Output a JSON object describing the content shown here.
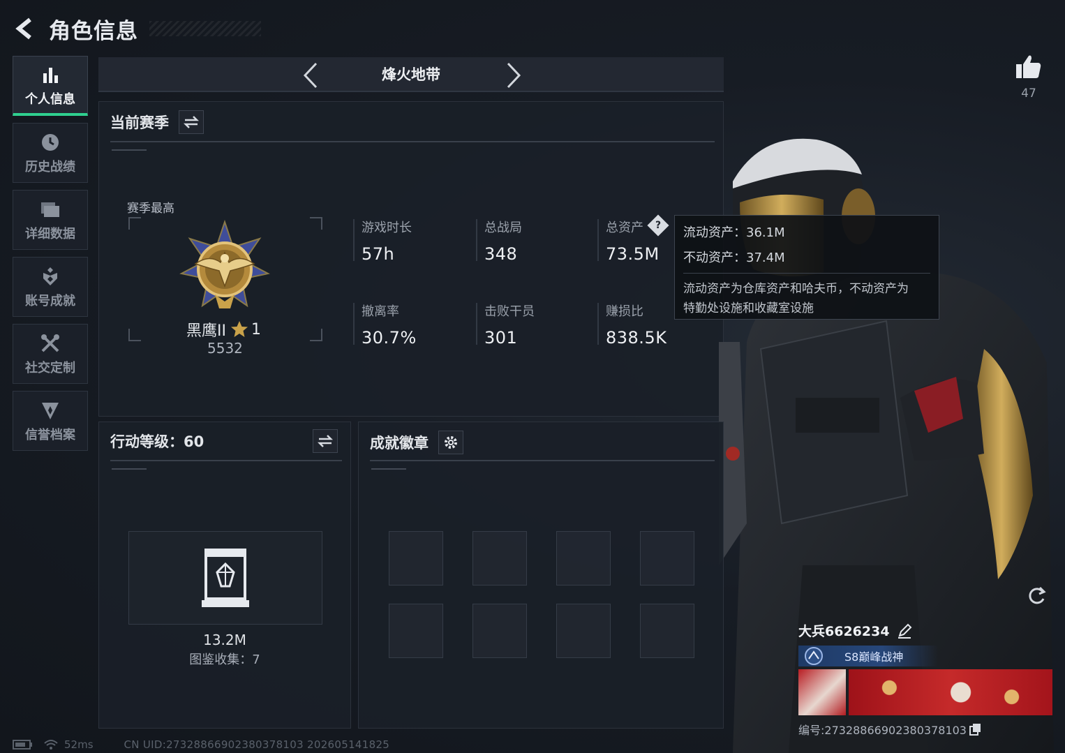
{
  "header": {
    "title": "角色信息"
  },
  "sidebar": {
    "items": [
      {
        "label": "个人信息",
        "icon": "bar-chart-icon",
        "active": true
      },
      {
        "label": "历史战绩",
        "icon": "history-icon",
        "active": false
      },
      {
        "label": "详细数据",
        "icon": "folder-icon",
        "active": false
      },
      {
        "label": "账号成就",
        "icon": "achievement-icon",
        "active": false
      },
      {
        "label": "社交定制",
        "icon": "tools-icon",
        "active": false
      },
      {
        "label": "信誉档案",
        "icon": "reputation-icon",
        "active": false
      }
    ]
  },
  "mode": {
    "title": "烽火地带"
  },
  "season": {
    "title": "当前赛季",
    "best_label": "赛季最高",
    "rank_name": "黑鹰II",
    "rank_stars": "1",
    "rank_score": "5532",
    "stats": [
      {
        "label": "游戏时长",
        "value": "57h"
      },
      {
        "label": "总战局",
        "value": "348"
      },
      {
        "label": "总资产",
        "value": "73.5M"
      },
      {
        "label": "撤离率",
        "value": "30.7%"
      },
      {
        "label": "击败干员",
        "value": "301"
      },
      {
        "label": "赚损比",
        "value": "838.5K"
      }
    ]
  },
  "tooltip": {
    "liquid": "流动资产：36.1M",
    "fixed": "不动资产：37.4M",
    "note_line1": "流动资产为仓库资产和哈夫币，不动资产为",
    "note_line2": "特勤处设施和收藏室设施"
  },
  "action": {
    "title": "行动等级：60",
    "collection_value": "13.2M",
    "collection_count": "图鉴收集：7"
  },
  "achievement": {
    "title": "成就徽章"
  },
  "likes": {
    "count": "47"
  },
  "player": {
    "name": "大兵6626234",
    "title": "S8巅峰战神",
    "id": "编号:27328866902380378103"
  },
  "footer": {
    "ping": "52ms",
    "uid": "CN UID:27328866902380378103 202605141825"
  },
  "colors": {
    "accent": "#2fd08f",
    "badge_gold": "#c9a24a",
    "badge_blue": "#3f4d9a"
  }
}
